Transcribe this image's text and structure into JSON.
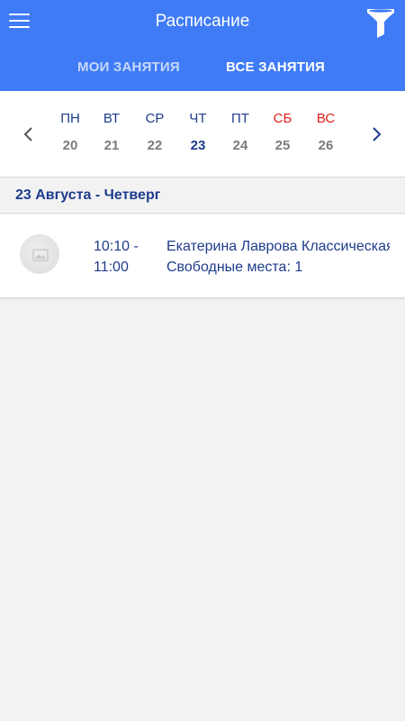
{
  "header": {
    "title": "Расписание",
    "menu_icon": "hamburger-menu-icon",
    "filter_icon": "funnel-filter-icon",
    "background_color": "#3f7bf5"
  },
  "tabs": [
    {
      "label": "МОИ ЗАНЯТИЯ",
      "active": false
    },
    {
      "label": "ВСЕ ЗАНЯТИЯ",
      "active": true
    }
  ],
  "week": {
    "prev_icon": "chevron-left-icon",
    "next_icon": "chevron-right-icon",
    "days": [
      {
        "dow": "ПН",
        "date": "20"
      },
      {
        "dow": "ВТ",
        "date": "21"
      },
      {
        "dow": "СР",
        "date": "22"
      },
      {
        "dow": "ЧТ",
        "date": "23"
      },
      {
        "dow": "ПТ",
        "date": "24"
      },
      {
        "dow": "СБ",
        "date": "25"
      },
      {
        "dow": "ВС",
        "date": "26"
      }
    ],
    "selected_date": "23",
    "weekend_color": "#e0201d"
  },
  "section": {
    "date_heading": "23 Августа - Четверг"
  },
  "classes": [
    {
      "time_start": "10:10 -",
      "time_end": "11:00",
      "title": "Екатерина Лаврова Классическая",
      "free_places": "Свободные места: 1",
      "image_icon": "image-placeholder-icon"
    }
  ]
}
